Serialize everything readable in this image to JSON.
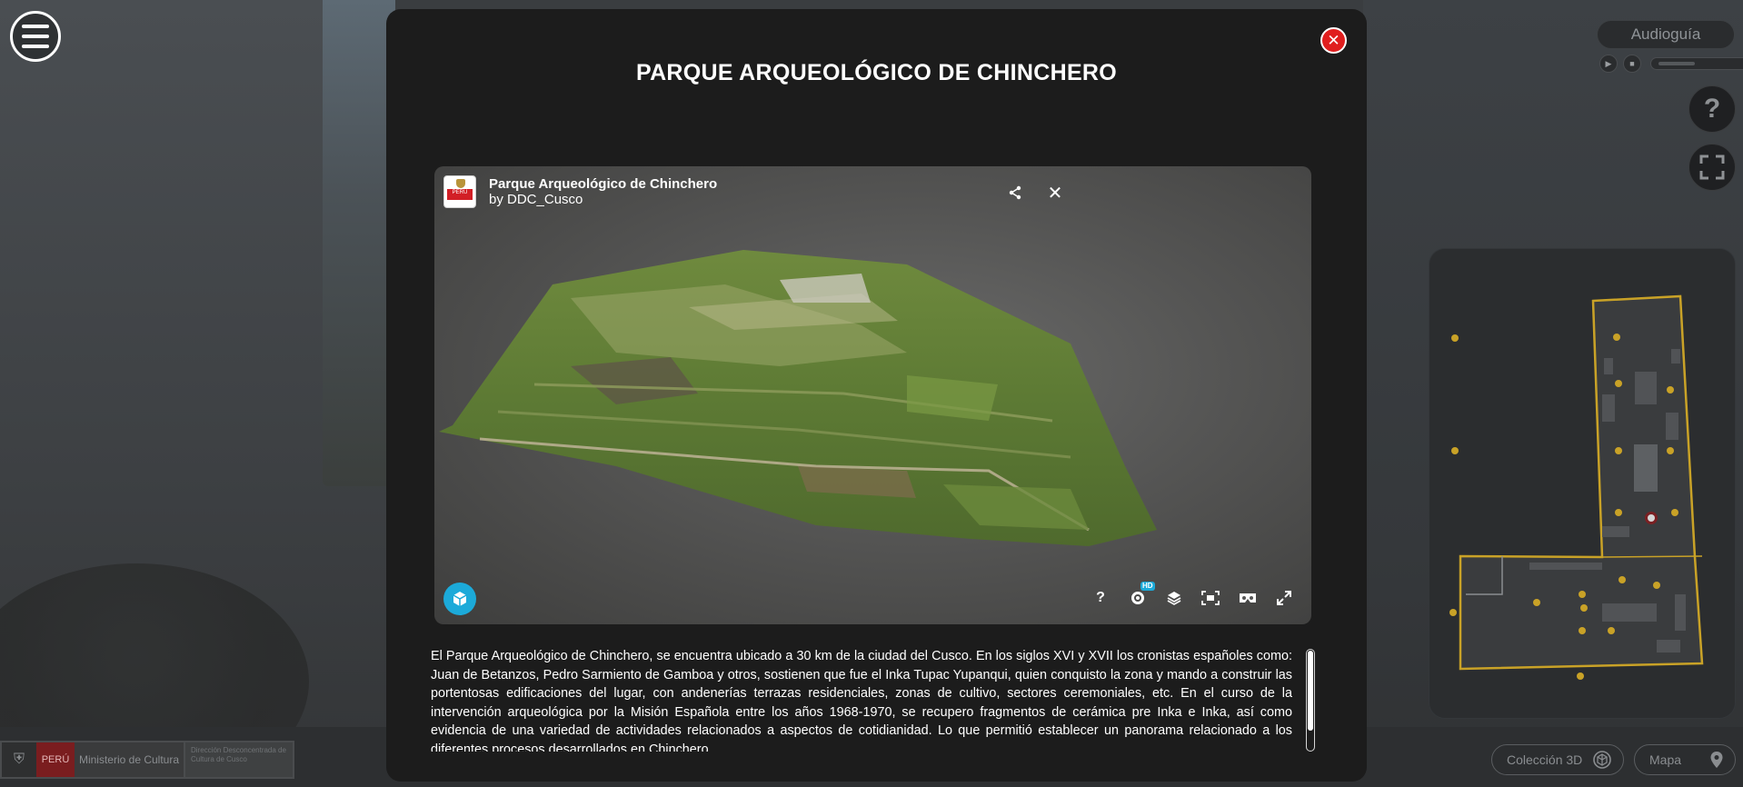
{
  "modal": {
    "title": "PARQUE ARQUEOLÓGICO DE CHINCHERO",
    "close_label": "✕"
  },
  "viewer": {
    "model_name": "Parque Arqueológico de Chinchero",
    "author_prefix": "by",
    "author": "DDC_Cusco",
    "avatar_text": "PERÚ",
    "hd_badge": "HD",
    "icons": [
      "share-icon",
      "close-icon",
      "help-icon",
      "settings-icon",
      "layers-icon",
      "ar-icon",
      "vr-icon",
      "fullscreen-icon",
      "sketchfab-logo"
    ]
  },
  "description": "El Parque Arqueológico de Chinchero, se encuentra ubicado a 30 km de la ciudad del Cusco. En los siglos XVI y XVII los cronistas españoles como: Juan de Betanzos, Pedro Sarmiento de Gamboa y otros, sostienen que fue el Inka Tupac Yupanqui, quien conquisto la zona y mando a construir las portentosas edificaciones del lugar, con andenerías terrazas residenciales, zonas de cultivo, sectores ceremoniales, etc. En el curso de la intervención arqueológica por la Misión Española entre los años 1968-1970, se recupero fragmentos de cerámica pre Inka e Inka, así como evidencia de una variedad de actividades relacionados a aspectos de cotidianidad. Lo que permitió establecer un panorama relacionado a los diferentes procesos desarrollados en Chinchero.",
  "audio": {
    "label": "Audioguía"
  },
  "side_buttons": {
    "help": "?",
    "fullscreen_icon": "expand-icon"
  },
  "footer": {
    "peru": "PERÚ",
    "ministry": "Ministerio de Cultura",
    "directorate": "Dirección Desconcentrada de Cultura de Cusco",
    "collection_button": "Colección 3D",
    "map_button": "Mapa"
  },
  "colors": {
    "modal_bg": "#1c1c1c",
    "close_red": "#e01e1e",
    "sketchfab_blue": "#1caad9",
    "map_yellow": "#c9a227"
  }
}
